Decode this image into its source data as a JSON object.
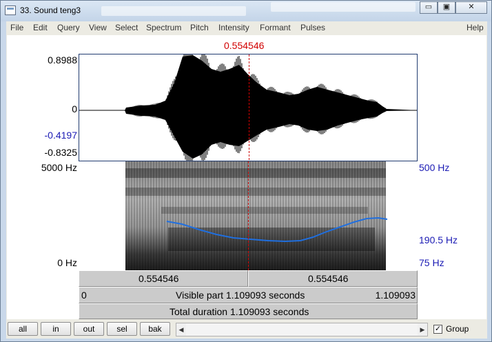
{
  "window": {
    "title": "33. Sound teng3",
    "buttons": {
      "minimize": "▭",
      "maximize": "▣",
      "close": "✕"
    }
  },
  "menu": [
    "File",
    "Edit",
    "Query",
    "View",
    "Select",
    "Spectrum",
    "Pitch",
    "Intensity",
    "Formant",
    "Pulses"
  ],
  "help": "Help",
  "cursor": {
    "time": "0.554546",
    "time_fraction": 0.5
  },
  "waveform": {
    "y_max": "0.8988",
    "y_zero": "0",
    "y_cursor_value": "-0.4197",
    "y_min": "-0.8325"
  },
  "spectrogram": {
    "top_freq": "5000 Hz",
    "bottom_freq": "0 Hz",
    "pitch_top": "500 Hz",
    "pitch_mid": "190.5 Hz",
    "pitch_bottom": "75 Hz"
  },
  "time_bars": {
    "left_segment": "0.554546",
    "right_segment": "0.554546",
    "visible_start": "0",
    "visible_label": "Visible part 1.109093 seconds",
    "visible_end": "1.109093",
    "total_label": "Total duration 1.109093 seconds"
  },
  "bottom": {
    "buttons": [
      "all",
      "in",
      "out",
      "sel",
      "bak"
    ],
    "group_label": "Group",
    "group_checked": "✓",
    "scroll_left": "◀",
    "scroll_right": "▶"
  },
  "colors": {
    "cursor": "#d10000",
    "pitch": "#1f6fe0",
    "axis_blue": "#1a1ab4"
  }
}
